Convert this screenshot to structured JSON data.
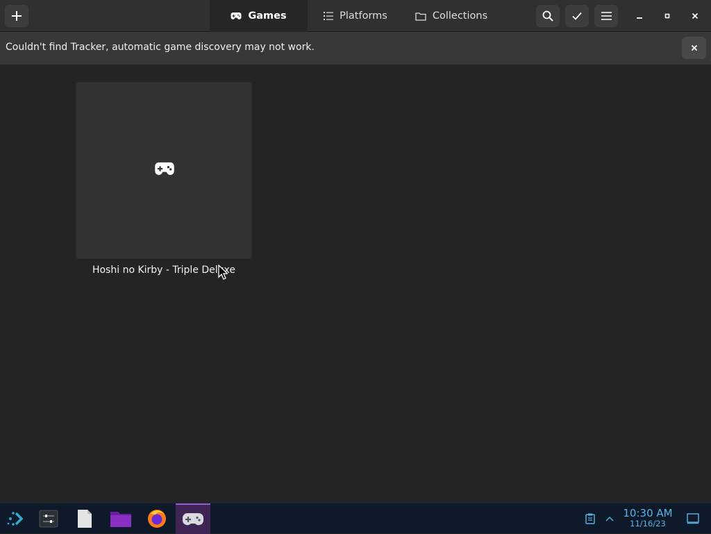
{
  "header": {
    "add_button_icon": "plus-icon",
    "tabs": [
      {
        "label": "Games",
        "icon": "gamepad-icon",
        "active": true
      },
      {
        "label": "Platforms",
        "icon": "list-icon",
        "active": false
      },
      {
        "label": "Collections",
        "icon": "folder-icon",
        "active": false
      }
    ],
    "actions": [
      "search-icon",
      "check-icon",
      "hamburger-menu-icon"
    ],
    "window_controls": [
      "minimize-icon",
      "maximize-icon",
      "close-icon"
    ]
  },
  "banner": {
    "message": "Couldn't find Tracker, automatic game discovery may not work.",
    "close_icon": "close-icon"
  },
  "games": [
    {
      "title": "Hoshi no Kirby - Triple Deluxe",
      "cover_icon": "gamepad-icon"
    }
  ],
  "taskbar": {
    "launchers": [
      "application-launcher-icon",
      "system-settings-icon",
      "text-document-icon",
      "file-manager-folder-icon",
      "firefox-icon",
      "game-controller-icon"
    ],
    "tray": [
      "clipboard-icon",
      "chevron-up-icon",
      "show-desktop-icon"
    ],
    "clock": {
      "time": "10:30 AM",
      "date": "11/16/23"
    }
  },
  "colors": {
    "window_bg": "#242424",
    "headerbar_bg": "#303030",
    "banner_bg": "#3a3835",
    "taskbar_bg": "#0e1a2a",
    "clock_text": "#5ab3e6",
    "active_task_accent": "#9b59d0"
  }
}
